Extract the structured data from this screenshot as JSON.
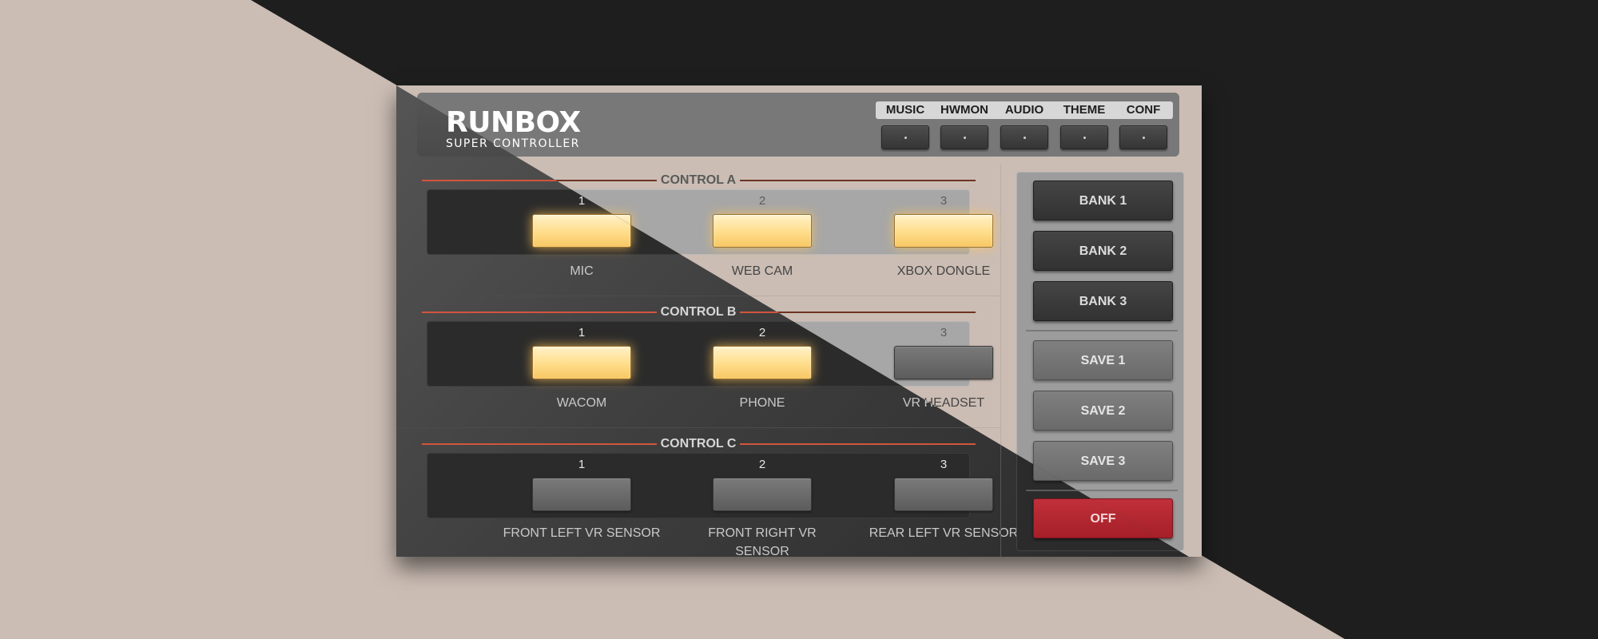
{
  "app": {
    "logo_title": "RUNBOX",
    "logo_subtitle": "SUPER CONTROLLER"
  },
  "tabs": [
    {
      "label": "MUSIC"
    },
    {
      "label": "HWMON"
    },
    {
      "label": "AUDIO"
    },
    {
      "label": "THEME"
    },
    {
      "label": "CONF"
    }
  ],
  "sections": [
    {
      "title": "CONTROL A",
      "slots": [
        {
          "number": "1",
          "label": "MIC",
          "state": "on"
        },
        {
          "number": "2",
          "label": "WEB CAM",
          "state": "on"
        },
        {
          "number": "3",
          "label": "XBOX DONGLE",
          "state": "on"
        }
      ]
    },
    {
      "title": "CONTROL B",
      "slots": [
        {
          "number": "1",
          "label": "WACOM",
          "state": "on"
        },
        {
          "number": "2",
          "label": "PHONE",
          "state": "on"
        },
        {
          "number": "3",
          "label": "VR HEADSET",
          "state": "off"
        }
      ]
    },
    {
      "title": "CONTROL C",
      "slots": [
        {
          "number": "1",
          "label": "FRONT LEFT VR SENSOR",
          "state": "off"
        },
        {
          "number": "2",
          "label": "FRONT RIGHT VR SENSOR",
          "state": "off"
        },
        {
          "number": "3",
          "label": "REAR LEFT VR SENSOR",
          "state": "off"
        }
      ]
    }
  ],
  "sidebar": {
    "banks": [
      {
        "label": "BANK 1"
      },
      {
        "label": "BANK 2"
      },
      {
        "label": "BANK 3"
      }
    ],
    "saves": [
      {
        "label": "SAVE 1"
      },
      {
        "label": "SAVE 2"
      },
      {
        "label": "SAVE 3"
      }
    ],
    "power_label": "OFF"
  },
  "colors": {
    "background_light": "#cbbdb4",
    "background_dark": "#1e1e1e",
    "led_on": "#ffdd8a",
    "accent_line": "#d2553e",
    "power_button": "#b0262f"
  }
}
